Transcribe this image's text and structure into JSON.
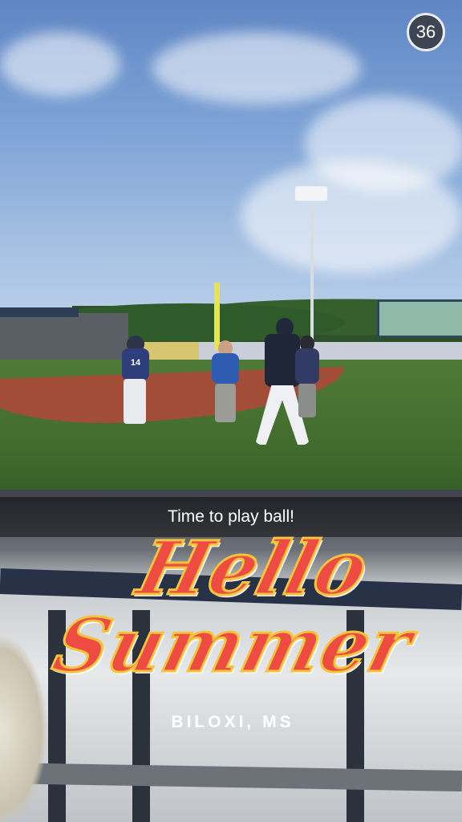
{
  "snap": {
    "counter": "36",
    "caption": "Time to play ball!"
  },
  "geofilter": {
    "line1": "Hello",
    "line2": "Summer",
    "location": "BILOXI, MS",
    "colors": {
      "fill": "#ee4b42",
      "outline": "#f4c43b",
      "text": "#ffffff"
    }
  },
  "player_number": "14"
}
